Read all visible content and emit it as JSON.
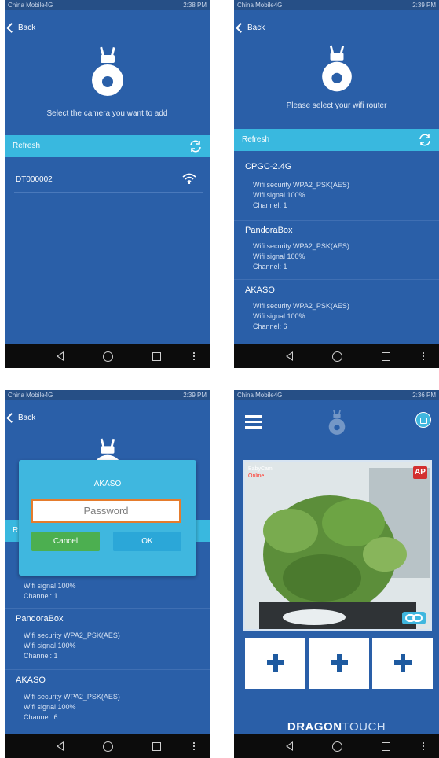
{
  "status": {
    "carrier": "China Mobile4G",
    "icons_right": "⊙ ≋ ᵢₗ ▬",
    "times": [
      "2:38 PM",
      "2:39 PM",
      "2:39 PM",
      "2:36 PM"
    ]
  },
  "common": {
    "back_label": "Back",
    "refresh_label": "Refresh"
  },
  "screen1": {
    "subtitle": "Select the camera you want to add",
    "devices": [
      {
        "name": "DT000002"
      }
    ]
  },
  "screen2": {
    "subtitle": "Please select your wifi router",
    "networks": [
      {
        "name": "CPGC-2.4G",
        "security": "Wifi security  WPA2_PSK(AES)",
        "signal": "Wifi signal  100%",
        "channel": "Channel:  1"
      },
      {
        "name": "PandoraBox",
        "security": "Wifi security  WPA2_PSK(AES)",
        "signal": "Wifi signal  100%",
        "channel": "Channel:  1"
      },
      {
        "name": "AKASO",
        "security": "Wifi security  WPA2_PSK(AES)",
        "signal": "Wifi signal  100%",
        "channel": "Channel:  6"
      }
    ]
  },
  "screen3": {
    "dialog": {
      "title": "AKASO",
      "password_placeholder": "Password",
      "cancel": "Cancel",
      "ok": "OK"
    },
    "networks_below": [
      {
        "name": "",
        "security": "",
        "signal": "Wifi signal  100%",
        "channel": "Channel:  1"
      },
      {
        "name": "PandoraBox",
        "security": "Wifi security  WPA2_PSK(AES)",
        "signal": "Wifi signal  100%",
        "channel": "Channel:  1"
      },
      {
        "name": "AKASO",
        "security": "Wifi security  WPA2_PSK(AES)",
        "signal": "Wifi signal  100%",
        "channel": "Channel:  6"
      }
    ]
  },
  "screen4": {
    "camera_overlay_name": "BabyCam",
    "camera_overlay_status": "Online",
    "ap_badge": "AP",
    "brand_main": "DRAGON",
    "brand_sub": "TOUCH"
  },
  "colors": {
    "bg": "#2a5fa8",
    "accent": "#39b8df",
    "cancel": "#4caf50",
    "ok": "#2ba7d8",
    "pw_border": "#e57c2d"
  }
}
